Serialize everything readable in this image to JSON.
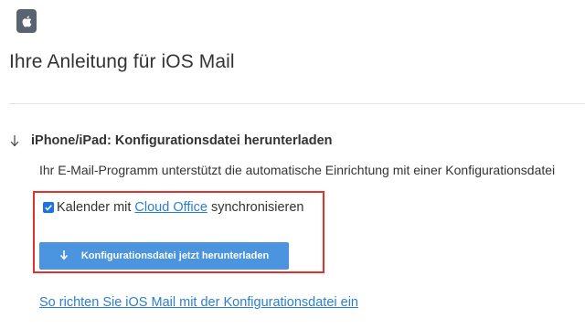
{
  "header": {
    "app_icon": "apple-logo-icon",
    "title": "Ihre Anleitung für iOS Mail"
  },
  "section": {
    "toggle_icon": "arrow-down-icon",
    "title": "iPhone/iPad: Konfigurationsdatei herunterladen",
    "description": "Ihr E-Mail-Programm unterstützt die automatische Einrichtung mit einer Konfigurationsdatei"
  },
  "options": {
    "calendar_sync": {
      "checked": true,
      "label_before": "Kalender mit",
      "link_text": "Cloud Office",
      "label_after": "synchronisieren"
    }
  },
  "download": {
    "icon": "arrow-down-icon",
    "label": "Konfigurationsdatei jetzt herunterladen"
  },
  "help_link": {
    "text": "So richten Sie iOS Mail mit der Konfigurationsdatei ein"
  },
  "colors": {
    "accent": "#4a94e0",
    "link": "#2a7fd4",
    "highlight_border": "#e0312b",
    "checkbox": "#1a73e8"
  }
}
